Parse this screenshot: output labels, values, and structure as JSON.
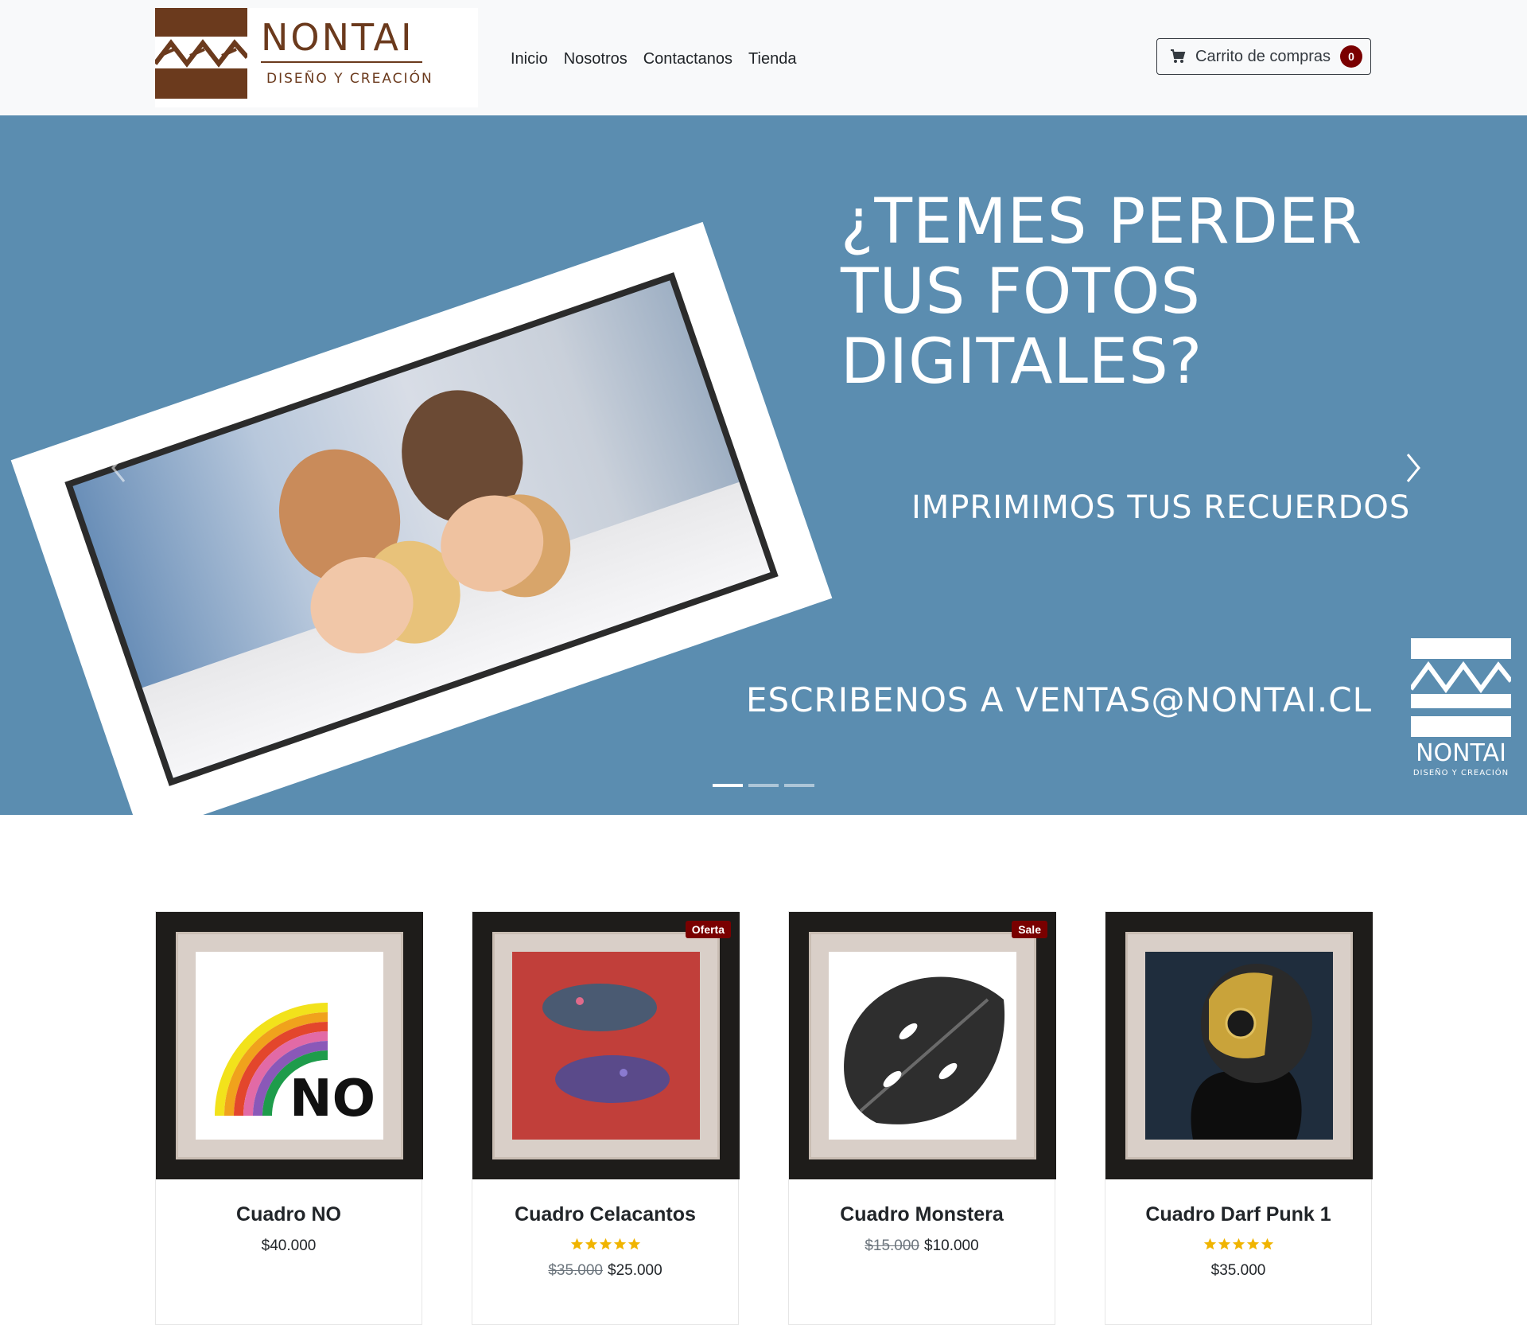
{
  "brand": {
    "name": "NONTAI",
    "tagline": "DISEÑO Y CREACIÓN"
  },
  "nav": {
    "links": [
      "Inicio",
      "Nosotros",
      "Contactanos",
      "Tienda"
    ]
  },
  "cart": {
    "label": "Carrito de compras",
    "count": "0"
  },
  "hero": {
    "title_line1": "¿TEMES PERDER TUS FOTOS",
    "title_line2": "DIGITALES?",
    "subtitle": "IMPRIMIMOS TUS RECUERDOS",
    "email_line": "ESCRIBENOS A VENTAS@NONTAI.CL",
    "logo_word": "NONTAI",
    "logo_tag": "DISEÑO Y CREACIÓN",
    "slides": 3,
    "active_slide": 1
  },
  "products": [
    {
      "title": "Cuadro NO",
      "badge": "",
      "rating": 0,
      "old_price": "",
      "price": "$40.000"
    },
    {
      "title": "Cuadro Celacantos",
      "badge": "Oferta",
      "rating": 5,
      "old_price": "$35.000",
      "price": "$25.000"
    },
    {
      "title": "Cuadro Monstera",
      "badge": "Sale",
      "rating": 0,
      "old_price": "$15.000",
      "price": "$10.000"
    },
    {
      "title": "Cuadro Darf Punk 1",
      "badge": "",
      "rating": 5,
      "old_price": "",
      "price": "$35.000"
    }
  ],
  "colors": {
    "hero_bg": "#5b8db0",
    "brand_brown": "#6b3a1d",
    "badge_red": "#7a0000",
    "star": "#f0b400"
  },
  "icons": {
    "cart": "cart-icon",
    "prev": "chevron-left-icon",
    "next": "chevron-right-icon",
    "star": "star-icon"
  }
}
